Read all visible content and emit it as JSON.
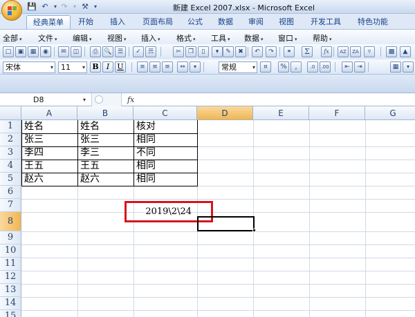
{
  "window": {
    "title": "新建 Excel 2007.xlsx - Microsoft Excel",
    "quick_access": [
      "save-icon",
      "undo-icon",
      "redo-icon",
      "tools-icon"
    ]
  },
  "ribbon": {
    "tabs": [
      {
        "label": "经典菜单",
        "active": true
      },
      {
        "label": "开始"
      },
      {
        "label": "插入"
      },
      {
        "label": "页面布局"
      },
      {
        "label": "公式"
      },
      {
        "label": "数据"
      },
      {
        "label": "审阅"
      },
      {
        "label": "视图"
      },
      {
        "label": "开发工具"
      },
      {
        "label": "特色功能"
      }
    ]
  },
  "menu": {
    "items": [
      "全部",
      "文件",
      "编辑",
      "视图",
      "插入",
      "格式",
      "工具",
      "数据",
      "窗口",
      "帮助"
    ]
  },
  "toolbar": {
    "font_name": "宋体",
    "font_size": "11",
    "bold": "B",
    "italic": "I",
    "underline": "U",
    "number_format": "常规",
    "percent": "%",
    "comma": ",",
    "sigma": "Σ",
    "fx": "fx"
  },
  "formula_bar": {
    "name_box": "D8",
    "fx_label": "fx",
    "content": ""
  },
  "sheet": {
    "columns": [
      "A",
      "B",
      "C",
      "D",
      "E",
      "F",
      "G"
    ],
    "selected_column": "D",
    "rows": [
      "1",
      "2",
      "3",
      "4",
      "5",
      "6",
      "7",
      "8",
      "9",
      "10",
      "11",
      "12",
      "13",
      "14",
      "15"
    ],
    "selected_row": "8",
    "active_cell": "D8",
    "cells": {
      "A1": "姓名",
      "B1": "姓名",
      "C1": "核对",
      "A2": "张三",
      "B2": "张三",
      "C2": "相同",
      "A3": "李四",
      "B3": "李三",
      "C3": "不同",
      "A4": "王五",
      "B4": "王五",
      "C4": "相同",
      "A5": "赵六",
      "B5": "赵六",
      "C5": "相同",
      "C7": "2019\\2\\24"
    },
    "highlight_color": "#d6141b"
  }
}
